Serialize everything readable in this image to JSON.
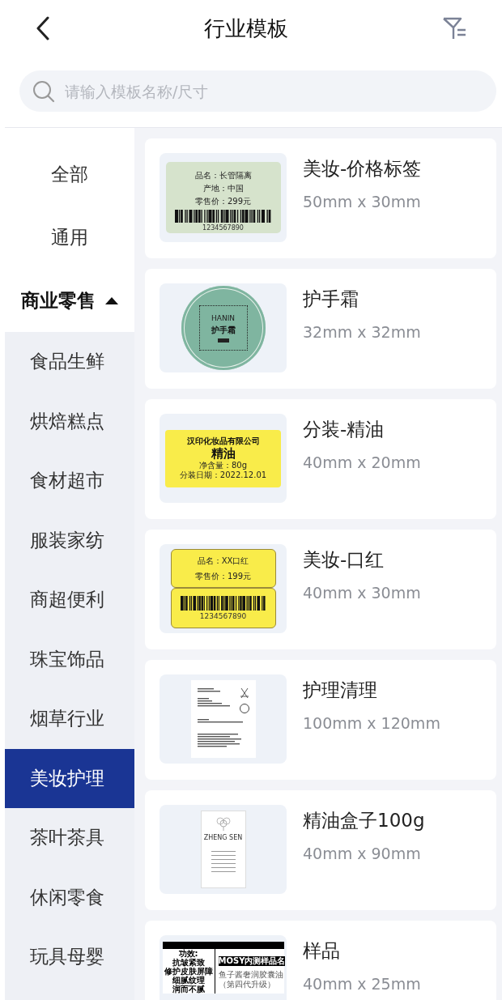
{
  "header": {
    "title": "行业模板"
  },
  "search": {
    "placeholder": "请输入模板名称/尺寸"
  },
  "categories": [
    {
      "label": "全部",
      "selected": false
    },
    {
      "label": "通用",
      "selected": false
    },
    {
      "label": "商业零售",
      "selected": false,
      "expanded": true,
      "children": [
        {
          "label": "食品生鲜",
          "selected": false
        },
        {
          "label": "烘焙糕点",
          "selected": false
        },
        {
          "label": "食材超市",
          "selected": false
        },
        {
          "label": "服装家纺",
          "selected": false
        },
        {
          "label": "商超便利",
          "selected": false
        },
        {
          "label": "珠宝饰品",
          "selected": false
        },
        {
          "label": "烟草行业",
          "selected": false
        },
        {
          "label": "美妆护理",
          "selected": true
        },
        {
          "label": "茶叶茶具",
          "selected": false
        },
        {
          "label": "休闲零食",
          "selected": false
        },
        {
          "label": "玩具母婴",
          "selected": false
        }
      ]
    }
  ],
  "templates": [
    {
      "name": "美妆-价格标签",
      "size": "50mm x 30mm",
      "preview": {
        "kind": "price-tag",
        "lines": [
          "品名：长管隔离",
          "产地：中国",
          "零售价：299元"
        ],
        "barcode": "1234567890"
      }
    },
    {
      "name": "护手霜",
      "size": "32mm x 32mm",
      "preview": {
        "kind": "seal",
        "brand": "HANIN",
        "product": "护手霜"
      }
    },
    {
      "name": "分装-精油",
      "size": "40mm x 20mm",
      "preview": {
        "kind": "product-label",
        "company": "汉印化妆品有限公司",
        "product": "精油",
        "lines": [
          "净含量：80g",
          "分装日期：2022.12.01"
        ]
      }
    },
    {
      "name": "美妆-口红",
      "size": "40mm x 30mm",
      "preview": {
        "kind": "split-tag",
        "lines": [
          "品名：XX口红",
          "零售价：199元"
        ],
        "barcode": "1234567890"
      }
    },
    {
      "name": "护理清理",
      "size": "100mm x 120mm",
      "preview": {
        "kind": "document"
      }
    },
    {
      "name": "精油盒子100g",
      "size": "40mm x 90mm",
      "preview": {
        "kind": "booklet",
        "brand": "ZHENG SEN"
      }
    },
    {
      "name": "样品",
      "size": "40mm x 25mm",
      "preview": {
        "kind": "sample-label",
        "lines": [
          "功效:",
          "抗皱紧致",
          "修护皮肤屏障",
          "细腻纹理",
          "润而不腻"
        ],
        "product": "MOSY内测样品名",
        "note": "鱼子酱奢润胶囊油（第四代升级）"
      }
    }
  ]
}
